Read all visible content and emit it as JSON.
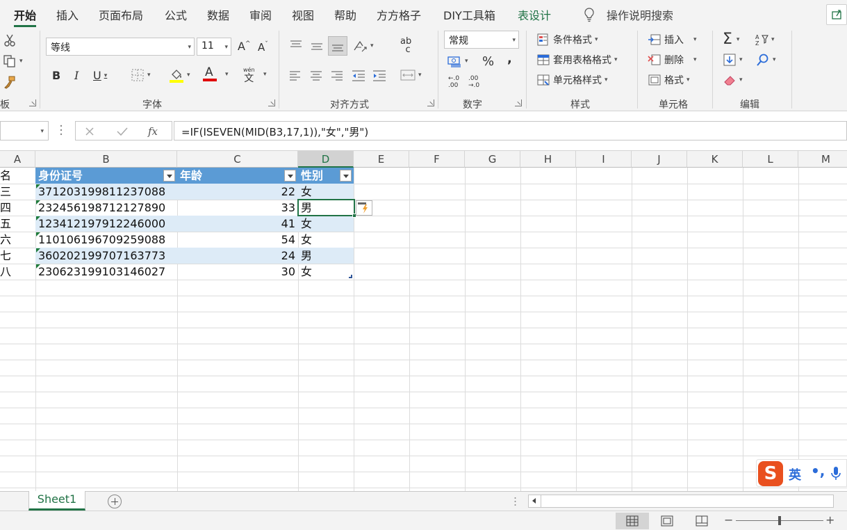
{
  "tabs": [
    {
      "label": "开始",
      "active": true
    },
    {
      "label": "插入"
    },
    {
      "label": "页面布局"
    },
    {
      "label": "公式"
    },
    {
      "label": "数据"
    },
    {
      "label": "审阅"
    },
    {
      "label": "视图"
    },
    {
      "label": "帮助"
    },
    {
      "label": "方方格子"
    },
    {
      "label": "DIY工具箱"
    },
    {
      "label": "表设计",
      "contextual": true
    }
  ],
  "search_label": "操作说明搜索",
  "ribbon": {
    "clipboard": {
      "label": "板"
    },
    "font": {
      "label": "字体",
      "font_name": "等线",
      "font_size": "11",
      "grow": "A",
      "shrink": "A",
      "bold": "B",
      "italic": "I",
      "underline": "U",
      "font_color": "A",
      "phonetic_top": "wén",
      "phonetic_bottom": "文"
    },
    "alignment": {
      "label": "对齐方式",
      "wrap_top": "ab",
      "wrap_bottom": "c"
    },
    "number": {
      "label": "数字",
      "format": "常规",
      "percent": "%",
      "comma": ",",
      "inc_decimal": "←.0 .00",
      "dec_decimal": ".00 →.0"
    },
    "styles": {
      "label": "样式",
      "conditional": "条件格式",
      "table_format": "套用表格格式",
      "cell_styles": "单元格样式"
    },
    "cells": {
      "label": "单元格",
      "insert": "插入",
      "delete": "删除",
      "format": "格式"
    },
    "editing": {
      "label": "编辑",
      "sum": "Σ"
    }
  },
  "formula_bar": {
    "name_box": "",
    "formula": "=IF(ISEVEN(MID(B3,17,1)),\"女\",\"男\")"
  },
  "columns": [
    "A",
    "B",
    "C",
    "D",
    "E",
    "F",
    "G",
    "H",
    "I",
    "J",
    "K",
    "L",
    "M"
  ],
  "table": {
    "headers": [
      "名",
      "身份证号",
      "年龄",
      "性别"
    ],
    "rows": [
      [
        "三",
        "371203199811237088",
        "22",
        "女"
      ],
      [
        "四",
        "232456198712127890",
        "33",
        "男"
      ],
      [
        "五",
        "123412197912246000",
        "41",
        "女"
      ],
      [
        "六",
        "110106196709259088",
        "54",
        "女"
      ],
      [
        "七",
        "360202199707163773",
        "24",
        "男"
      ],
      [
        "八",
        "230623199103146027",
        "30",
        "女"
      ]
    ]
  },
  "sheet": {
    "name": "Sheet1"
  },
  "ime": {
    "logo": "S",
    "lang": "英",
    "punct": "•,"
  },
  "colors": {
    "accent": "#217346",
    "table_header": "#5b9bd5",
    "table_band": "#ddebf7"
  }
}
